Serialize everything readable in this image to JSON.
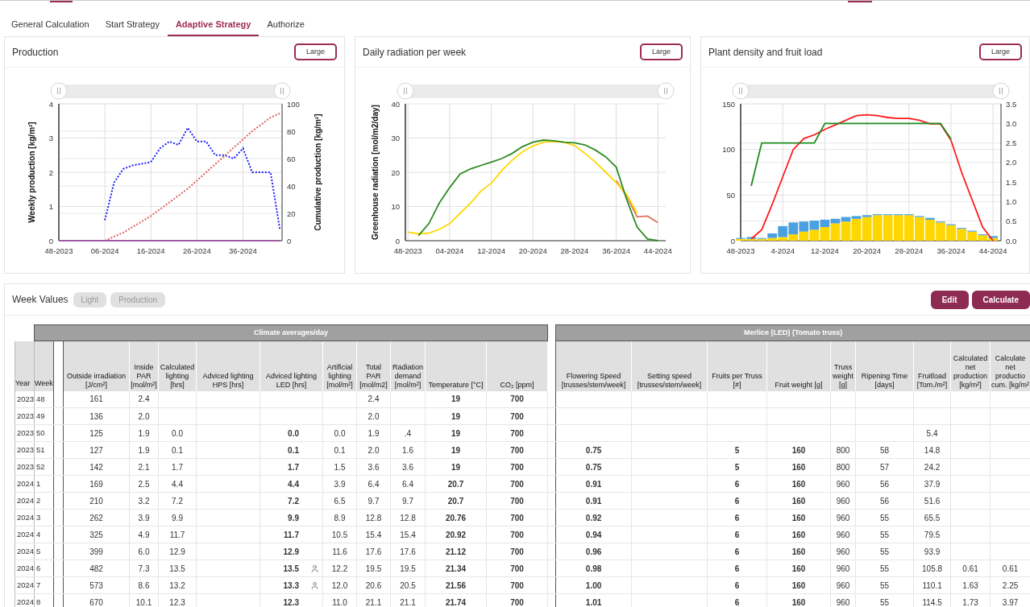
{
  "tabs": [
    {
      "label": "General Calculation",
      "selected": false
    },
    {
      "label": "Start Strategy",
      "selected": false
    },
    {
      "label": "Adaptive Strategy",
      "selected": true
    },
    {
      "label": "Authorize",
      "selected": false
    }
  ],
  "panels": [
    {
      "title": "Production",
      "button": "Large",
      "chart_data": {
        "type": "line",
        "grid": true,
        "ylabel": "Weekly production [kg/m²]",
        "y2label": "Cumulative production [kg/m²]",
        "categories": [
          "48-2023",
          null,
          null,
          null,
          null,
          "06-2024",
          null,
          null,
          null,
          null,
          "16-2024",
          null,
          null,
          null,
          null,
          "26-2024",
          null,
          null,
          null,
          null,
          "36-2024",
          null,
          null,
          null,
          null
        ],
        "ylim": [
          0,
          4
        ],
        "y2lim": [
          0,
          100
        ],
        "yticks": [
          0,
          1,
          2,
          3,
          4
        ],
        "y2ticks": [
          0,
          20,
          40,
          60,
          80,
          100
        ],
        "series": [
          {
            "color": "#1f1fff",
            "line_style": "dotted",
            "values": [
              null,
              null,
              null,
              null,
              null,
              0.6,
              1.7,
              2.1,
              2.2,
              2.25,
              2.3,
              2.7,
              2.9,
              2.8,
              3.3,
              2.9,
              2.9,
              2.5,
              2.5,
              2.4,
              2.7,
              2.0,
              2.0,
              2.0,
              0.35
            ]
          },
          {
            "color": "#e06060",
            "line_style": "dotted",
            "axis": "y2",
            "values": [
              null,
              null,
              null,
              null,
              null,
              0,
              3,
              6,
              10,
              14,
              18,
              23,
              28,
              33,
              38,
              44,
              50,
              56,
              62,
              68,
              74,
              80,
              85,
              90,
              93
            ]
          },
          {
            "color": "#a05aa0",
            "values": [
              0,
              0,
              0,
              0,
              0,
              0,
              0,
              0,
              0,
              0,
              0,
              0,
              0,
              0,
              0,
              0,
              0,
              0,
              0,
              0,
              0,
              0,
              0,
              0,
              0
            ]
          }
        ]
      }
    },
    {
      "title": "Daily radiation per week",
      "button": "Large",
      "chart_data": {
        "type": "line",
        "grid": true,
        "ylabel": "Greenhouse radiation [mol/m2/day]",
        "categories": [
          "48-2023",
          null,
          null,
          null,
          "04-2024",
          null,
          null,
          null,
          "12-2024",
          null,
          null,
          null,
          "20-2024",
          null,
          null,
          null,
          "28-2024",
          null,
          null,
          null,
          "36-2024",
          null,
          null,
          null,
          "44-2024"
        ],
        "ylim": [
          0,
          40
        ],
        "yticks": [
          0,
          10,
          20,
          30,
          40
        ],
        "series": [
          {
            "color": "#e07060",
            "values": [
              null,
              null,
              null,
              null,
              null,
              null,
              null,
              null,
              null,
              null,
              null,
              null,
              null,
              null,
              null,
              null,
              null,
              null,
              null,
              null,
              17.5,
              13,
              7,
              7.2,
              5.3
            ]
          },
          {
            "color": "#ffd700",
            "values": [
              2.5,
              2.0,
              2.2,
              3.3,
              5,
              8,
              11,
              14.5,
              16.8,
              20.5,
              23.5,
              26,
              27.7,
              28.8,
              29,
              28.8,
              27.8,
              25.5,
              23,
              20,
              17,
              13.5,
              8,
              null,
              null
            ]
          },
          {
            "color": "#2e8b22",
            "values": [
              null,
              1.5,
              5,
              11,
              15.5,
              19.5,
              21,
              22,
              23,
              24,
              25.5,
              27.5,
              28.8,
              29.4,
              29.2,
              28.8,
              28.6,
              28,
              26.5,
              24.5,
              21.5,
              12,
              4,
              0.5,
              0
            ]
          }
        ]
      }
    },
    {
      "title": "Plant density and fruit load",
      "button": "Large",
      "chart_data": {
        "type": "bar",
        "stacked": true,
        "grid": true,
        "categories": [
          "48-2023",
          null,
          null,
          null,
          "4-2024",
          null,
          null,
          null,
          "12-2024",
          null,
          null,
          null,
          "20-2024",
          null,
          null,
          null,
          "28-2024",
          null,
          null,
          null,
          "36-2024",
          null,
          null,
          null,
          "44-2024"
        ],
        "ylim": [
          0,
          150
        ],
        "y2lim": [
          0,
          3.5
        ],
        "yticks": [
          0,
          50,
          100,
          150
        ],
        "y2ticks": [
          {
            "value": 0,
            "label": "0.0"
          },
          {
            "value": 0.5,
            "label": "0.5"
          },
          {
            "value": 1,
            "label": "1.0"
          },
          {
            "value": 1.5,
            "label": "1.5"
          },
          {
            "value": 2,
            "label": "2.0"
          },
          {
            "value": 2.5,
            "label": "2.5"
          },
          {
            "value": 3,
            "label": "3.0"
          },
          {
            "value": 3.5,
            "label": "3.5"
          }
        ],
        "series": [
          {
            "color": "#ffd700",
            "values": [
              2,
              2,
              2,
              3,
              4,
              7,
              10,
              12,
              15,
              19,
              21,
              24,
              26,
              28,
              28,
              28,
              28,
              26,
              23,
              20,
              17,
              13,
              10,
              6,
              3
            ]
          },
          {
            "color": "#4aa0e0",
            "values": [
              1,
              2,
              1,
              5,
              12,
              13,
              11,
              10,
              8,
              5,
              5,
              3,
              2,
              1,
              1,
              1,
              1,
              1,
              2,
              1,
              1,
              1,
              1,
              1,
              2
            ]
          },
          {
            "type": "line",
            "color": "#ff1a1a",
            "values": [
              null,
              2,
              12,
              40,
              70,
              100,
              112,
              116,
              122,
              127,
              132,
              137,
              138,
              137,
              135,
              134,
              134,
              132,
              128,
              128,
              110,
              75,
              45,
              15,
              0
            ]
          },
          {
            "type": "line",
            "color": "#1e8a1e",
            "axis": "y2",
            "values": [
              null,
              1.4,
              2.5,
              2.5,
              2.5,
              2.5,
              2.5,
              2.5,
              3.0,
              3.0,
              3.0,
              3.0,
              3.0,
              3.0,
              3.0,
              3.0,
              3.0,
              3.0,
              3.0,
              3.0,
              2.6,
              null,
              null,
              null,
              null
            ]
          }
        ]
      }
    }
  ],
  "week_values": {
    "title": "Week Values",
    "filters": [
      {
        "label": "Light",
        "selected": false
      },
      {
        "label": "Production",
        "selected": false
      }
    ],
    "actions": [
      "Edit",
      "Calculate"
    ]
  },
  "table": {
    "key_columns": [
      {
        "label": "Year"
      },
      {
        "label": "Week"
      }
    ],
    "groups": [
      {
        "label": "Climate averages/day",
        "columns": [
          {
            "label": "Outside irradiation [J/cm²]"
          },
          {
            "label": "Inside PAR [mol/m²]"
          },
          {
            "label": "Calculated lighting [hrs]"
          },
          {
            "label": "Adviced lighting HPS [hrs]"
          },
          {
            "label": "Adviced lighting LED [hrs]"
          },
          {
            "label": "Artificial lighting [mol/m²]"
          },
          {
            "label": "Total PAR [mol/m2]"
          },
          {
            "label": "Radiation demand [mol/m²]"
          },
          {
            "label": "Temperature [°C]"
          },
          {
            "label": "CO₂ [ppm]"
          }
        ]
      },
      {
        "label": "Merlice (LED) (Tomato truss)",
        "columns": [
          {
            "label": "Flowering Speed [trusses/stem/week]"
          },
          {
            "label": "Setting speed [trusses/stem/week]"
          },
          {
            "label": "Fruits per Truss [#]"
          },
          {
            "label": "Fruit weight [g]"
          },
          {
            "label": "Truss weight [g]"
          },
          {
            "label": "Ripening Time [days]"
          },
          {
            "label": "Fruitload [Tom./m²]"
          },
          {
            "label": "Calculated net production [kg/m²]"
          },
          {
            "label": "Calculate net productio cum. [kg/m²"
          }
        ]
      }
    ],
    "rows": [
      {
        "annotated": false,
        "cells": [
          "2023",
          "48",
          "161",
          "2.4",
          null,
          null,
          null,
          null,
          "2.4",
          null,
          "19",
          "700",
          null,
          null,
          null,
          null,
          null,
          null,
          null,
          null,
          null
        ]
      },
      {
        "annotated": false,
        "cells": [
          "2023",
          "49",
          "136",
          "2.0",
          null,
          null,
          null,
          null,
          "2.0",
          null,
          "19",
          "700",
          null,
          null,
          null,
          null,
          null,
          null,
          null,
          null,
          null
        ]
      },
      {
        "annotated": false,
        "cells": [
          "2023",
          "50",
          "125",
          "1.9",
          "0.0",
          null,
          "0.0",
          "0.0",
          "1.9",
          ".4",
          "19",
          "700",
          null,
          null,
          null,
          null,
          null,
          null,
          "5.4",
          null,
          null
        ]
      },
      {
        "annotated": false,
        "cells": [
          "2023",
          "51",
          "127",
          "1.9",
          "0.1",
          null,
          "0.1",
          "0.1",
          "2.0",
          "1.6",
          "19",
          "700",
          "0.75",
          null,
          "5",
          "160",
          "800",
          "58",
          "14.8",
          null,
          null
        ]
      },
      {
        "annotated": false,
        "cells": [
          "2023",
          "52",
          "142",
          "2.1",
          "1.7",
          null,
          "1.7",
          "1.5",
          "3.6",
          "3.6",
          "19",
          "700",
          "0.75",
          null,
          "5",
          "160",
          "800",
          "57",
          "24.2",
          null,
          null
        ]
      },
      {
        "annotated": false,
        "cells": [
          "2024",
          "1",
          "169",
          "2.5",
          "4.4",
          null,
          "4.4",
          "3.9",
          "6.4",
          "6.4",
          "20.7",
          "700",
          "0.91",
          null,
          "6",
          "160",
          "960",
          "56",
          "37.9",
          null,
          null
        ]
      },
      {
        "annotated": false,
        "cells": [
          "2024",
          "2",
          "210",
          "3.2",
          "7.2",
          null,
          "7.2",
          "6.5",
          "9.7",
          "9.7",
          "20.7",
          "700",
          "0.91",
          null,
          "6",
          "160",
          "960",
          "56",
          "51.6",
          null,
          null
        ]
      },
      {
        "annotated": false,
        "cells": [
          "2024",
          "3",
          "262",
          "3.9",
          "9.9",
          null,
          "9.9",
          "8.9",
          "12.8",
          "12.8",
          "20.76",
          "700",
          "0.92",
          null,
          "6",
          "160",
          "960",
          "55",
          "65.5",
          null,
          null
        ]
      },
      {
        "annotated": false,
        "cells": [
          "2024",
          "4",
          "325",
          "4.9",
          "11.7",
          null,
          "11.7",
          "10.5",
          "15.4",
          "15.4",
          "20.92",
          "700",
          "0.94",
          null,
          "6",
          "160",
          "960",
          "55",
          "79.5",
          null,
          null
        ]
      },
      {
        "annotated": false,
        "cells": [
          "2024",
          "5",
          "399",
          "6.0",
          "12.9",
          null,
          "12.9",
          "11.6",
          "17.6",
          "17.6",
          "21.12",
          "700",
          "0.96",
          null,
          "6",
          "160",
          "960",
          "55",
          "93.9",
          null,
          null
        ]
      },
      {
        "annotated": true,
        "cells": [
          "2024",
          "6",
          "482",
          "7.3",
          "13.5",
          null,
          "13.5",
          "12.2",
          "19.5",
          "19.5",
          "21.34",
          "700",
          "0.98",
          null,
          "6",
          "160",
          "960",
          "55",
          "105.8",
          "0.61",
          "0.61"
        ]
      },
      {
        "annotated": true,
        "cells": [
          "2024",
          "7",
          "573",
          "8.6",
          "13.2",
          null,
          "13.3",
          "12.0",
          "20.6",
          "20.5",
          "21.56",
          "700",
          "1.00",
          null,
          "6",
          "160",
          "960",
          "55",
          "110.1",
          "1.63",
          "2.25"
        ]
      },
      {
        "annotated": false,
        "cells": [
          "2024",
          "8",
          "670",
          "10.1",
          "12.3",
          null,
          "12.3",
          "11.0",
          "21.1",
          "21.1",
          "21.74",
          "700",
          "1.01",
          null,
          "6",
          "160",
          "960",
          "55",
          "114.5",
          "1.73",
          "3.97"
        ]
      }
    ]
  }
}
